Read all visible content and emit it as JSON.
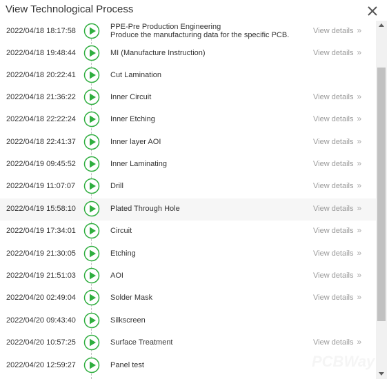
{
  "dialog": {
    "title": "View Technological Process",
    "close_icon": "close-icon"
  },
  "colors": {
    "node_green": "#2fae3f",
    "timeline": "#bfbfbf",
    "muted_text": "#999999"
  },
  "process": {
    "rows": [
      {
        "time": "2022/04/18 18:17:58",
        "step": "PPE-Pre Production Engineering",
        "desc": "Produce the manufacturing data for the specific PCB.",
        "view": "View details"
      },
      {
        "time": "2022/04/18 19:48:44",
        "step": "MI (Manufacture Instruction)",
        "view": "View details"
      },
      {
        "time": "2022/04/18 20:22:41",
        "step": "Cut Lamination"
      },
      {
        "time": "2022/04/18 21:36:22",
        "step": "Inner Circuit",
        "view": "View details"
      },
      {
        "time": "2022/04/18 22:22:24",
        "step": "Inner Etching",
        "view": "View details"
      },
      {
        "time": "2022/04/18 22:41:37",
        "step": "Inner layer AOI",
        "view": "View details"
      },
      {
        "time": "2022/04/19 09:45:52",
        "step": "Inner Laminating",
        "view": "View details"
      },
      {
        "time": "2022/04/19 11:07:07",
        "step": "Drill",
        "view": "View details"
      },
      {
        "time": "2022/04/19 15:58:10",
        "step": "Plated Through Hole",
        "view": "View details",
        "highlighted": true
      },
      {
        "time": "2022/04/19 17:34:01",
        "step": "Circuit",
        "view": "View details"
      },
      {
        "time": "2022/04/19 21:30:05",
        "step": "Etching",
        "view": "View details"
      },
      {
        "time": "2022/04/19 21:51:03",
        "step": "AOI",
        "view": "View details"
      },
      {
        "time": "2022/04/20 02:49:04",
        "step": "Solder Mask",
        "view": "View details"
      },
      {
        "time": "2022/04/20 09:43:40",
        "step": "Silkscreen"
      },
      {
        "time": "2022/04/20 10:57:25",
        "step": "Surface Treatment",
        "view": "View details"
      },
      {
        "time": "2022/04/20 12:59:27",
        "step": "Panel test"
      }
    ]
  },
  "watermark": "PCBWay"
}
